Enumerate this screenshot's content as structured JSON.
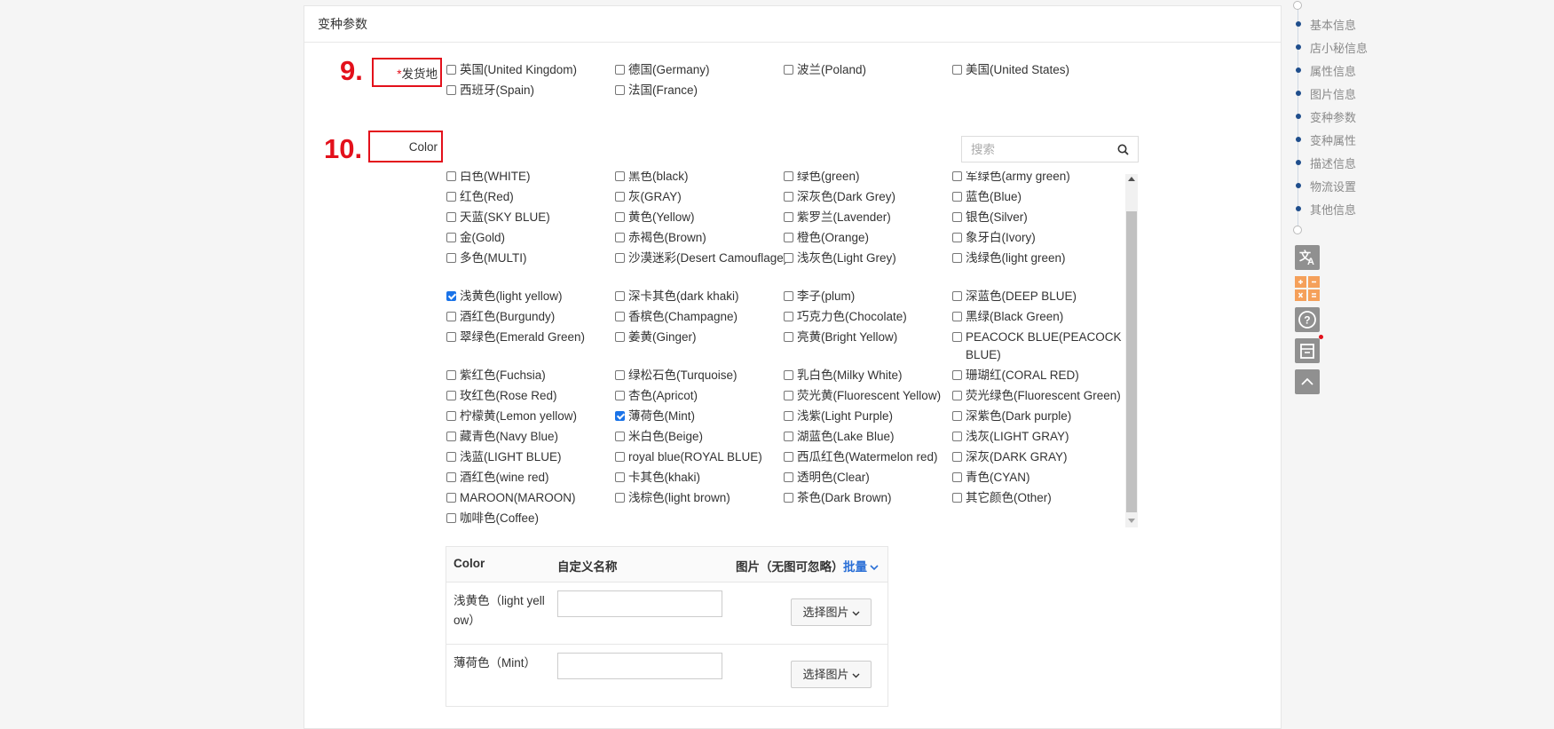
{
  "section": {
    "title": "变种参数"
  },
  "annotations": {
    "n9": "9.",
    "n10": "10."
  },
  "ship_from": {
    "label": "发货地",
    "required_mark": "*",
    "options": [
      {
        "label": "英国(United Kingdom)",
        "checked": false
      },
      {
        "label": "德国(Germany)",
        "checked": false
      },
      {
        "label": "波兰(Poland)",
        "checked": false
      },
      {
        "label": "美国(United States)",
        "checked": false
      },
      {
        "label": "西班牙(Spain)",
        "checked": false
      },
      {
        "label": "法国(France)",
        "checked": false
      }
    ]
  },
  "color": {
    "label": "Color",
    "search_placeholder": "搜索",
    "options": [
      {
        "label": "白色(WHITE)",
        "checked": false
      },
      {
        "label": "黑色(black)",
        "checked": false
      },
      {
        "label": "绿色(green)",
        "checked": false
      },
      {
        "label": "军绿色(army green)",
        "checked": false
      },
      {
        "label": "红色(Red)",
        "checked": false
      },
      {
        "label": "灰(GRAY)",
        "checked": false
      },
      {
        "label": "深灰色(Dark Grey)",
        "checked": false
      },
      {
        "label": "蓝色(Blue)",
        "checked": false
      },
      {
        "label": "天蓝(SKY BLUE)",
        "checked": false
      },
      {
        "label": "黄色(Yellow)",
        "checked": false
      },
      {
        "label": "紫罗兰(Lavender)",
        "checked": false
      },
      {
        "label": "银色(Silver)",
        "checked": false
      },
      {
        "label": "金(Gold)",
        "checked": false
      },
      {
        "label": "赤褐色(Brown)",
        "checked": false
      },
      {
        "label": "橙色(Orange)",
        "checked": false
      },
      {
        "label": "象牙白(Ivory)",
        "checked": false
      },
      {
        "label": "多色(MULTI)",
        "checked": false
      },
      {
        "label": "沙漠迷彩(Desert Camouflage)",
        "checked": false
      },
      {
        "label": "浅灰色(Light Grey)",
        "checked": false
      },
      {
        "label": "浅绿色(light green)",
        "checked": false
      },
      {
        "label": "浅黄色(light yellow)",
        "checked": true
      },
      {
        "label": "深卡其色(dark khaki)",
        "checked": false
      },
      {
        "label": "李子(plum)",
        "checked": false
      },
      {
        "label": "深蓝色(DEEP BLUE)",
        "checked": false
      },
      {
        "label": "酒红色(Burgundy)",
        "checked": false
      },
      {
        "label": "香槟色(Champagne)",
        "checked": false
      },
      {
        "label": "巧克力色(Chocolate)",
        "checked": false
      },
      {
        "label": "黑绿(Black Green)",
        "checked": false
      },
      {
        "label": "翠绿色(Emerald Green)",
        "checked": false
      },
      {
        "label": "姜黄(Ginger)",
        "checked": false
      },
      {
        "label": "亮黄(Bright Yellow)",
        "checked": false
      },
      {
        "label": "PEACOCK BLUE(PEACOCK BLUE)",
        "checked": false
      },
      {
        "label": "紫红色(Fuchsia)",
        "checked": false
      },
      {
        "label": "绿松石色(Turquoise)",
        "checked": false
      },
      {
        "label": "乳白色(Milky White)",
        "checked": false
      },
      {
        "label": "珊瑚红(CORAL RED)",
        "checked": false
      },
      {
        "label": "玫红色(Rose Red)",
        "checked": false
      },
      {
        "label": "杏色(Apricot)",
        "checked": false
      },
      {
        "label": "荧光黄(Fluorescent Yellow)",
        "checked": false
      },
      {
        "label": "荧光绿色(Fluorescent Green)",
        "checked": false
      },
      {
        "label": "柠檬黄(Lemon yellow)",
        "checked": false
      },
      {
        "label": "薄荷色(Mint)",
        "checked": true
      },
      {
        "label": "浅紫(Light Purple)",
        "checked": false
      },
      {
        "label": "深紫色(Dark purple)",
        "checked": false
      },
      {
        "label": "藏青色(Navy Blue)",
        "checked": false
      },
      {
        "label": "米白色(Beige)",
        "checked": false
      },
      {
        "label": "湖蓝色(Lake Blue)",
        "checked": false
      },
      {
        "label": "浅灰(LIGHT GRAY)",
        "checked": false
      },
      {
        "label": "浅蓝(LIGHT BLUE)",
        "checked": false
      },
      {
        "label": "royal blue(ROYAL BLUE)",
        "checked": false
      },
      {
        "label": "西瓜红色(Watermelon red)",
        "checked": false
      },
      {
        "label": "深灰(DARK GRAY)",
        "checked": false
      },
      {
        "label": "酒红色(wine red)",
        "checked": false
      },
      {
        "label": "卡其色(khaki)",
        "checked": false
      },
      {
        "label": "透明色(Clear)",
        "checked": false
      },
      {
        "label": "青色(CYAN)",
        "checked": false
      },
      {
        "label": "MAROON(MAROON)",
        "checked": false
      },
      {
        "label": "浅棕色(light brown)",
        "checked": false
      },
      {
        "label": "茶色(Dark Brown)",
        "checked": false
      },
      {
        "label": "其它颜色(Other)",
        "checked": false
      },
      {
        "label": "咖啡色(Coffee)",
        "checked": false
      }
    ]
  },
  "variant_table": {
    "headers": {
      "color": "Color",
      "custom_name": "自定义名称",
      "image": "图片（无图可忽略）",
      "batch": "批量"
    },
    "rows": [
      {
        "color_line1": "浅黄色（light yell",
        "color_line2": "ow）",
        "custom_name": "",
        "button": "选择图片"
      },
      {
        "color_line1": "薄荷色（Mint）",
        "color_line2": "",
        "custom_name": "",
        "button": "选择图片"
      }
    ]
  },
  "side_nav": {
    "items": [
      "基本信息",
      "店小秘信息",
      "属性信息",
      "图片信息",
      "变种参数",
      "变种属性",
      "描述信息",
      "物流设置",
      "其他信息"
    ]
  },
  "colors": {
    "accent": "#1a73e8",
    "annotation": "#e3101b",
    "nav_dot": "#1f4e8c",
    "calc_orange": "#f5a05a"
  }
}
